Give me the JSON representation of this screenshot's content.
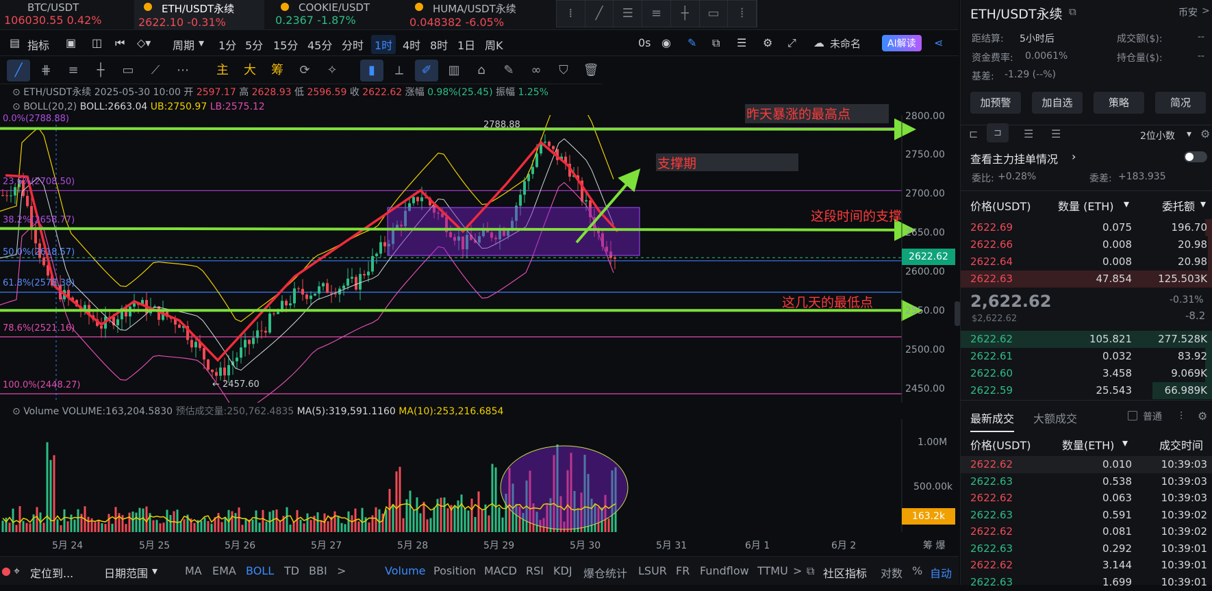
{
  "tickers": [
    {
      "name": "BTC/USDT",
      "price": "106030.55",
      "change": "0.42%",
      "dir": "up"
    },
    {
      "name": "ETH/USDT永续",
      "price": "2622.10",
      "change": "-0.31%",
      "dir": "down"
    },
    {
      "name": "COOKIE/USDT",
      "price": "0.2367",
      "change": "-1.87%",
      "dir": "down"
    },
    {
      "name": "HUMA/USDT永续",
      "price": "0.048382",
      "change": "-6.05%",
      "dir": "down"
    }
  ],
  "toolbar": {
    "indicator": "指标",
    "period": "周期",
    "intervals": [
      "1分",
      "5分",
      "15分",
      "45分",
      "分时",
      "1时",
      "4时",
      "8时",
      "1日",
      "周K"
    ],
    "active_interval": "1时",
    "countdown": "0s",
    "layout_name": "未命名",
    "ai_label": "AI解读"
  },
  "draw_tools": {
    "t1": "主",
    "t2": "大",
    "t3": "筹"
  },
  "info": {
    "symbol": "ETH/USDT永续",
    "date": "2025-05-30 10:00",
    "open_label": "开",
    "open": "2597.17",
    "high_label": "高",
    "high": "2628.93",
    "low_label": "低",
    "low": "2596.59",
    "close_label": "收",
    "close": "2622.62",
    "chg_label": "涨幅",
    "chg": "0.98%(25.45)",
    "amp_label": "振幅",
    "amp": "1.25%"
  },
  "boll": {
    "label": "BOLL(20,2)",
    "mid": "BOLL:2663.04",
    "ub": "UB:2750.97",
    "lb": "LB:2575.12"
  },
  "y_axis": [
    "2800.00",
    "2750.00",
    "2700.00",
    "2650.00",
    "2600.00",
    "2550.00",
    "2500.00",
    "2450.00"
  ],
  "current_price": "2622.62",
  "fib": [
    "0.0%(2788.88)",
    "23.6%(2708.50)",
    "38.2%(2658.77)",
    "50.0%(2618.57)",
    "61.8%(2578.38)",
    "78.6%(2521.16)",
    "100.0%(2448.27)"
  ],
  "peak_label": "2788.88",
  "low_label": "← 2457.60",
  "annotations": {
    "a1": "昨天暴涨的最高点",
    "a2": "支撑期",
    "a3": "这段时间的支撑",
    "a4": "这几天的最低点"
  },
  "volume": {
    "label": "Volume",
    "value": "VOLUME:163,204.5830",
    "est": "预估成交量:250,762.4835",
    "ma5": "MA(5):319,591.1160",
    "ma10": "MA(10):253,216.6854",
    "axis": [
      "1.00M",
      "500.00k"
    ],
    "tag": "163.2k"
  },
  "x_axis": [
    "5月 24",
    "5月 25",
    "5月 26",
    "5月 27",
    "5月 28",
    "5月 29",
    "5月 30",
    "5月 31",
    "6月 1",
    "6月 2"
  ],
  "x_right": "筹  爆",
  "bottom": {
    "locate": "定位到...",
    "range": "日期范围",
    "main_ind": [
      "MA",
      "EMA",
      "BOLL",
      "TD",
      "BBI"
    ],
    "sub_ind": [
      "Volume",
      "Position",
      "MACD",
      "RSI",
      "KDJ",
      "爆仓统计",
      "LSUR",
      "FR",
      "Fundflow",
      "TTMU"
    ],
    "community": "社区指标",
    "log": "对数",
    "pct": "%",
    "auto": "自动"
  },
  "side": {
    "pair": "ETH/USDT永续",
    "exchange": "币安",
    "settle_label": "距结算:",
    "settle": "5小时后",
    "turnover_label": "成交额($):",
    "turnover": "--",
    "funding_label": "资金费率:",
    "funding": "0.0061%",
    "oi_label": "持仓量($):",
    "oi": "--",
    "basis_label": "基差:",
    "basis": "-1.29 (--%)",
    "buttons": [
      "加预警",
      "加自选",
      "策略",
      "简况"
    ],
    "decimals": "2位小数",
    "whale": "查看主力挂单情况",
    "ratio_label": "委比:",
    "ratio": "+0.28%",
    "diff_label": "委差:",
    "diff": "+183.935",
    "ob_headers": [
      "价格(USDT)",
      "数量 (ETH)",
      "委托额"
    ],
    "asks": [
      [
        "2622.69",
        "0.075",
        "196.70"
      ],
      [
        "2622.66",
        "0.008",
        "20.98"
      ],
      [
        "2622.64",
        "0.008",
        "20.98"
      ],
      [
        "2622.63",
        "47.854",
        "125.503K"
      ]
    ],
    "mid_price": "2,622.62",
    "mid_usd": "$2,622.62",
    "mid_pct": "-0.31%",
    "mid_chg": "-8.2",
    "bids": [
      [
        "2622.62",
        "105.821",
        "277.528K"
      ],
      [
        "2622.61",
        "0.032",
        "83.92"
      ],
      [
        "2622.60",
        "3.458",
        "9.069K"
      ],
      [
        "2622.59",
        "25.543",
        "66.989K"
      ]
    ],
    "trades_tab": "最新成交",
    "big_tab": "大额成交",
    "normal": "普通",
    "tr_headers": [
      "价格(USDT)",
      "数量(ETH)",
      "成交时间"
    ],
    "trades": [
      [
        "2622.62",
        "0.010",
        "10:39:03",
        "r"
      ],
      [
        "2622.63",
        "0.538",
        "10:39:03",
        "g"
      ],
      [
        "2622.62",
        "0.063",
        "10:39:03",
        "r"
      ],
      [
        "2622.63",
        "0.591",
        "10:39:02",
        "g"
      ],
      [
        "2622.62",
        "0.081",
        "10:39:02",
        "r"
      ],
      [
        "2622.63",
        "0.292",
        "10:39:01",
        "g"
      ],
      [
        "2622.62",
        "3.144",
        "10:39:01",
        "r"
      ],
      [
        "2622.63",
        "1.699",
        "10:39:01",
        "g"
      ]
    ]
  },
  "colors": {
    "up": "#2ebd85",
    "down": "#ef4b55",
    "accent": "#3d8bff",
    "fib": "#b03cd6",
    "green_line": "#7ee03a"
  }
}
